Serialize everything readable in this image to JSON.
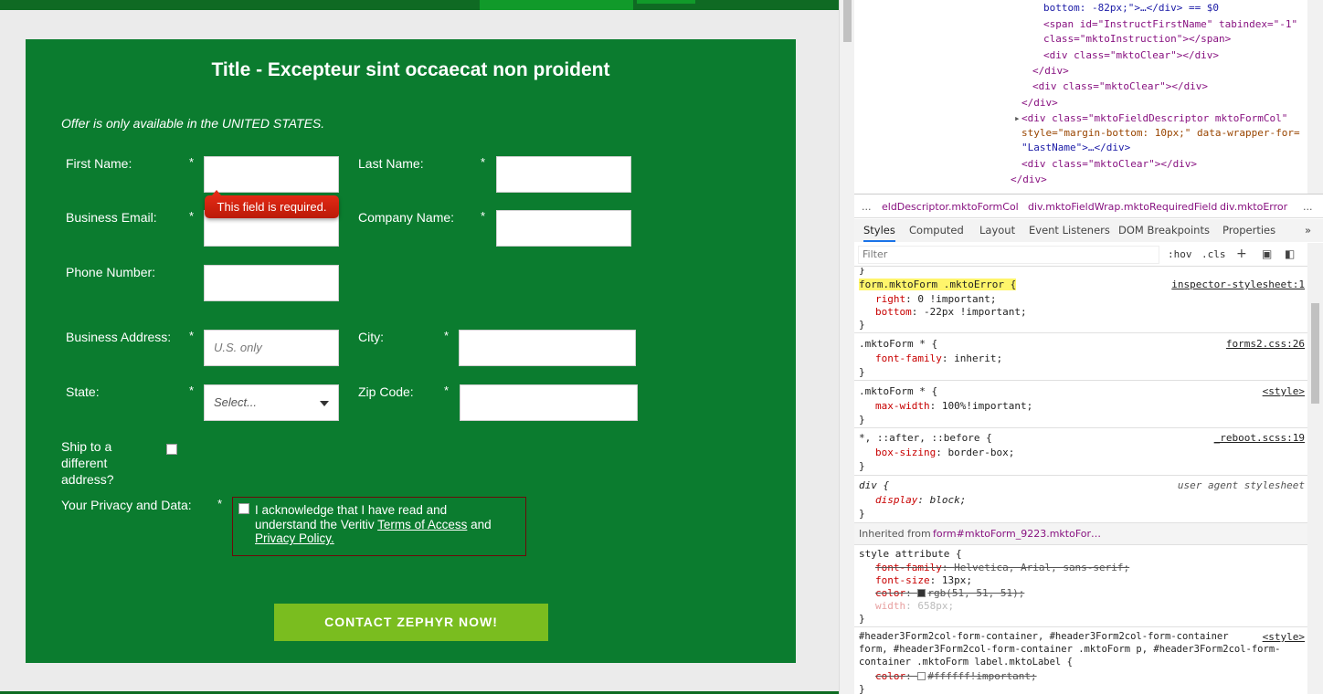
{
  "form": {
    "title": "Title - Excepteur sint occaecat non proident",
    "offer_note": "Offer is only available in the UNITED STATES.",
    "required_mark": "*",
    "fields": {
      "first_name_label": "First Name:",
      "last_name_label": "Last Name:",
      "business_email_label": "Business Email:",
      "company_name_label": "Company Name:",
      "phone_label": "Phone Number:",
      "address_label": "Business Address:",
      "address_placeholder": "U.S. only",
      "city_label": "City:",
      "state_label": "State:",
      "state_selected": "Select...",
      "zip_label": "Zip Code:",
      "ship_label_1": "Ship to a",
      "ship_label_2": "different",
      "ship_label_3": "address?",
      "privacy_label": "Your Privacy and Data:"
    },
    "error_message": "This field is required.",
    "privacy_text_1": "I acknowledge that I have read and",
    "privacy_text_2": "understand the Veritiv ",
    "terms_link": "Terms of Access",
    "privacy_text_3": " and",
    "privacy_link": "Privacy Policy.",
    "submit_label": "CONTACT ZEPHYR NOW!",
    "colors": {
      "card": "#0b7c2f",
      "button": "#7abd1f",
      "error": "#d42210"
    }
  },
  "devtools": {
    "dom_lines": {
      "l1": "bottom: -82px;\">…</div> == $0",
      "l2a": "<span id=\"InstructFirstName\" tabindex=\"-1\"",
      "l2b": "class=\"mktoInstruction\"></span>",
      "l3": "<div class=\"mktoClear\"></div>",
      "l4": "</div>",
      "l5": "<div class=\"mktoClear\"></div>",
      "l6": "</div>",
      "l7a": "<div class=\"mktoFieldDescriptor mktoFormCol\"",
      "l7b": "style=\"margin-bottom: 10px;\" data-wrapper-for=",
      "l7c": "\"LastName\">…</div>",
      "l8": "<div class=\"mktoClear\"></div>",
      "l9": "</div>"
    },
    "breadcrumb": {
      "more": "...",
      "item1": "eldDescriptor.mktoFormCol",
      "item2": "div.mktoFieldWrap.mktoRequiredField",
      "item3": "div.mktoError",
      "more_right": "..."
    },
    "tabs": [
      "Styles",
      "Computed",
      "Layout",
      "Event Listeners",
      "DOM Breakpoints",
      "Properties",
      "»"
    ],
    "filter_placeholder": "Filter",
    "hov": ":hov",
    "cls": ".cls",
    "rules": {
      "r1_selector": "form.mktoForm .mktoError {",
      "r1_src": "inspector-stylesheet:1",
      "r1_p1_name": "right",
      "r1_p1_val": "0 !important;",
      "r1_p2_name": "bottom",
      "r1_p2_val": "-22px !important;",
      "r2_selector": ".mktoForm * {",
      "r2_src": "forms2.css:26",
      "r2_p1_name": "font-family",
      "r2_p1_val": "inherit;",
      "r3_selector": ".mktoForm * {",
      "r3_src": "<style>",
      "r3_p1_name": "max-width",
      "r3_p1_val": "100%!important;",
      "r4_selector": "*, ::after, ::before {",
      "r4_src": "_reboot.scss:19",
      "r4_p1_name": "box-sizing",
      "r4_p1_val": "border-box;",
      "r5_selector": "div {",
      "r5_src": "user agent stylesheet",
      "r5_p1_name": "display",
      "r5_p1_val": "block;",
      "inherited_label": "Inherited from ",
      "inherited_from": "form#mktoForm_9223.mktoFor…",
      "r6_selector": "style attribute {",
      "r6_p1_name": "font-family",
      "r6_p1_val": "Helvetica, Arial, sans-serif;",
      "r6_p2_name": "font-size",
      "r6_p2_val": "13px;",
      "r6_p3_name": "color",
      "r6_p3_val": "rgb(51, 51, 51);",
      "r6_p4_name": "width",
      "r6_p4_val": "658px;",
      "r7_selector_1": "#header3Form2col-form-container, #header3Form2col-form-container",
      "r7_selector_2": "form, #header3Form2col-form-container .mktoForm p, #header3Form2col-form-",
      "r7_selector_3": "container .mktoForm label.mktoLabel {",
      "r7_src": "<style>",
      "r7_p1_name": "color",
      "r7_p1_val": "#ffffff!important;",
      "close": "}"
    }
  }
}
